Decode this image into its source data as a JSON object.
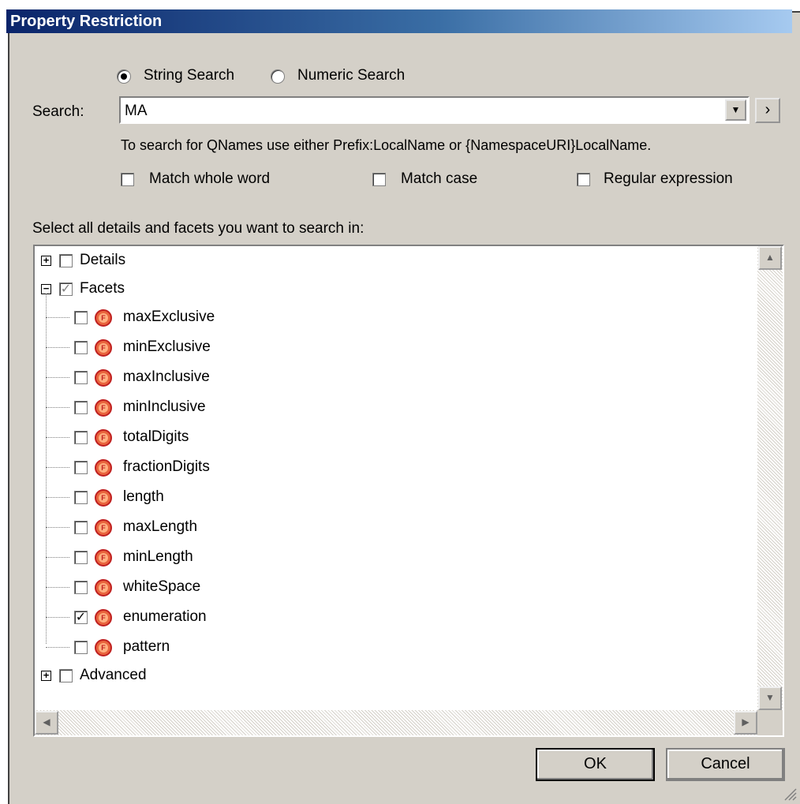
{
  "dialog": {
    "title": "Property Restriction"
  },
  "search_mode": {
    "string_label": "String Search",
    "numeric_label": "Numeric Search",
    "selected": "string"
  },
  "search": {
    "label": "Search:",
    "value": "MA",
    "hint": "To search for QNames use either Prefix:LocalName or {NamespaceURI}LocalName."
  },
  "options": {
    "match_whole_word": "Match whole word",
    "match_case": "Match case",
    "regular_expression": "Regular expression"
  },
  "tree": {
    "heading": "Select all details and facets you want to search in:",
    "details_label": "Details",
    "facets_label": "Facets",
    "advanced_label": "Advanced",
    "facets": [
      {
        "label": "maxExclusive",
        "checked": false
      },
      {
        "label": "minExclusive",
        "checked": false
      },
      {
        "label": "maxInclusive",
        "checked": false
      },
      {
        "label": "minInclusive",
        "checked": false
      },
      {
        "label": "totalDigits",
        "checked": false
      },
      {
        "label": "fractionDigits",
        "checked": false
      },
      {
        "label": "length",
        "checked": false
      },
      {
        "label": "maxLength",
        "checked": false
      },
      {
        "label": "minLength",
        "checked": false
      },
      {
        "label": "whiteSpace",
        "checked": false
      },
      {
        "label": "enumeration",
        "checked": true
      },
      {
        "label": "pattern",
        "checked": false
      }
    ]
  },
  "buttons": {
    "ok": "OK",
    "cancel": "Cancel"
  },
  "colors": {
    "titlebar_start": "#0a246a",
    "titlebar_end": "#a6caf0",
    "dialog_bg": "#d4d0c8",
    "facet_icon": "#e8653e"
  }
}
